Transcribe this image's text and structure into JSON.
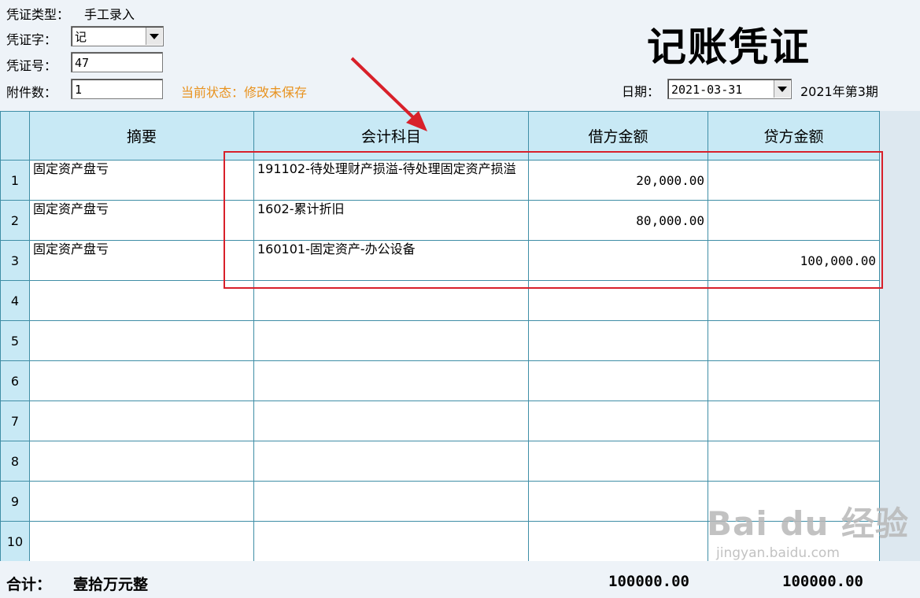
{
  "header": {
    "voucher_type_label": "凭证类型：",
    "voucher_type_value": "手工录入",
    "voucher_word_label": "凭证字：",
    "voucher_word_value": "记",
    "voucher_no_label": "凭证号：",
    "voucher_no_value": "47",
    "attachments_label": "附件数：",
    "attachments_value": "1",
    "status_text": "当前状态：修改未保存",
    "title": "记账凭证",
    "date_label": "日期：",
    "date_value": "2021-03-31",
    "period_text": "2021年第3期"
  },
  "table": {
    "columns": [
      "摘要",
      "会计科目",
      "借方金额",
      "贷方金额"
    ],
    "rows": [
      {
        "no": "1",
        "summary": "固定资产盘亏",
        "account": "191102-待处理财产损溢-待处理固定资产损溢",
        "debit": "20,000.00",
        "credit": ""
      },
      {
        "no": "2",
        "summary": "固定资产盘亏",
        "account": "1602-累计折旧",
        "debit": "80,000.00",
        "credit": ""
      },
      {
        "no": "3",
        "summary": "固定资产盘亏",
        "account": "160101-固定资产-办公设备",
        "debit": "",
        "credit": "100,000.00"
      },
      {
        "no": "4",
        "summary": "",
        "account": "",
        "debit": "",
        "credit": ""
      },
      {
        "no": "5",
        "summary": "",
        "account": "",
        "debit": "",
        "credit": ""
      },
      {
        "no": "6",
        "summary": "",
        "account": "",
        "debit": "",
        "credit": ""
      },
      {
        "no": "7",
        "summary": "",
        "account": "",
        "debit": "",
        "credit": ""
      },
      {
        "no": "8",
        "summary": "",
        "account": "",
        "debit": "",
        "credit": ""
      },
      {
        "no": "9",
        "summary": "",
        "account": "",
        "debit": "",
        "credit": ""
      },
      {
        "no": "10",
        "summary": "",
        "account": "",
        "debit": "",
        "credit": ""
      }
    ]
  },
  "totals": {
    "label": "合计：",
    "amount_in_words": "壹拾万元整",
    "debit_total": "100000.00",
    "credit_total": "100000.00"
  },
  "watermark": {
    "brand": "Bai du 经验",
    "site": "jingyan.baidu.com"
  },
  "colors": {
    "status": "#e8921e",
    "header_bg": "#c8e9f5",
    "grid_line": "#3f8ea6",
    "annotation_red": "#d8202a"
  }
}
